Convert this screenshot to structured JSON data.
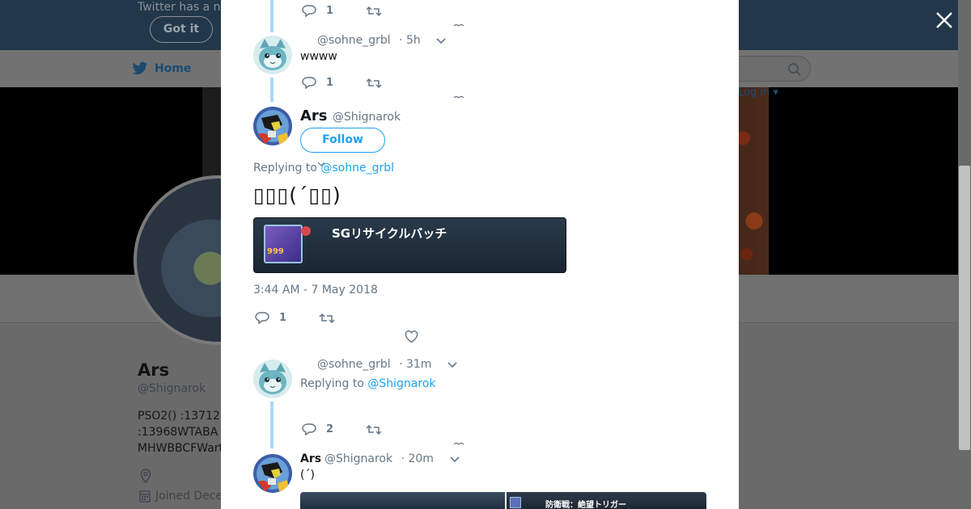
{
  "background": {
    "notice_text": "Twitter has a n",
    "got_it_label": "Got it",
    "nav_home_label": "Home",
    "login_label": "Log in",
    "profile_name": "Ars",
    "profile_handle": "@Shignarok",
    "bio_line1": "PSO2() :13712",
    "bio_line2": ":13968WTABA",
    "bio_line3": "MHWBBCFWart",
    "joined_label": "Joined Dece"
  },
  "modal": {
    "top_reply": {
      "reply_count": "1"
    },
    "tweet_a": {
      "handle": "@sohne_grbl",
      "time": "· 5h",
      "text": "wwww",
      "reply_count": "1"
    },
    "main_tweet": {
      "name": "Ars",
      "handle": "@Shignarok",
      "follow_label": "Follow",
      "replying_prefix": "Replying to",
      "replying_to": "@sohne_grbl",
      "text": "▯▯▯(´▯▯)",
      "image_caption": "SGリサイクルバッチ",
      "image_badge": "999",
      "timestamp": "3:44 AM - 7 May 2018",
      "reply_count": "1"
    },
    "tweet_b": {
      "handle": "@sohne_grbl",
      "time": "· 31m",
      "replying_prefix": "Replying to",
      "replying_to": "@Shignarok",
      "reply_count": "2"
    },
    "tweet_c": {
      "name": "Ars",
      "handle": "@Shignarok",
      "time": "· 20m",
      "text": "(´)",
      "image_caption": "防衛戦：絶望トリガー"
    }
  },
  "colors": {
    "accent": "#1da1f2",
    "thread_line": "#a7d8f8",
    "muted": "#657786"
  }
}
